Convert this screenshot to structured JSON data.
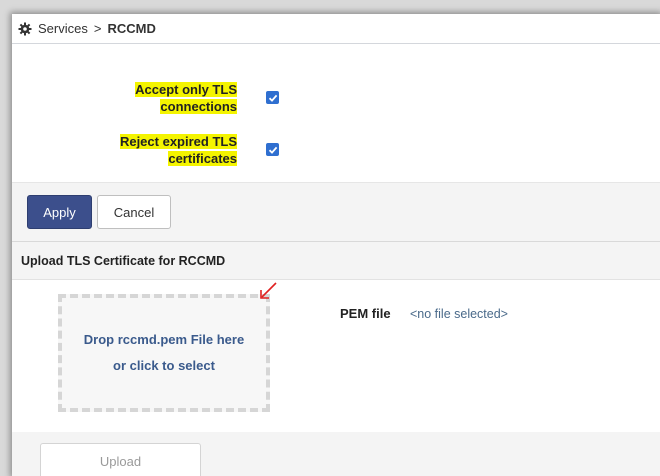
{
  "breadcrumb": {
    "parent": "Services",
    "separator": ">",
    "current": "RCCMD"
  },
  "settings": [
    {
      "label_line1": "Accept only TLS",
      "label_line2": "connections",
      "checked": true,
      "highlighted": true
    },
    {
      "label_line1": "Reject expired TLS",
      "label_line2": "certificates",
      "checked": true,
      "highlighted": true
    }
  ],
  "actions": {
    "apply_label": "Apply",
    "cancel_label": "Cancel"
  },
  "upload_section": {
    "title": "Upload TLS Certificate for RCCMD",
    "dropzone_line1": "Drop rccmd.pem File here",
    "dropzone_line2": "or click to select",
    "pem_label": "PEM file",
    "pem_value": "<no file selected>",
    "upload_label": "Upload"
  },
  "colors": {
    "primary": "#3c4f8c",
    "checkbox": "#2f6fd0",
    "highlight": "#f4f400",
    "annotation_arrow": "#e02020"
  }
}
